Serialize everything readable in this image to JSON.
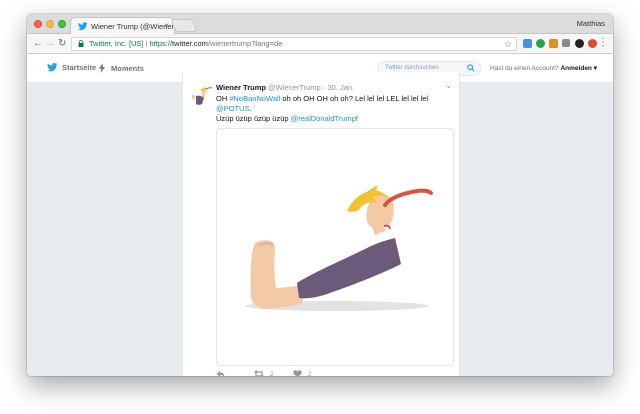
{
  "browser": {
    "tab_title": "Wiener Trump (@WienerTrump)",
    "tab_close": "×",
    "profile_name": "Matthias",
    "back_icon": "arrow-left-icon",
    "forward_icon": "arrow-right-icon",
    "reload_icon": "reload-icon",
    "secure_label": "Twitter, Inc. [US]",
    "url_scheme": "https://",
    "url_host": "twitter.com",
    "url_path": "/wienertrump?lang=de",
    "bookmark_icon": "star-icon",
    "menu_icon": "kebab-menu-icon"
  },
  "nav": {
    "home_label": "Startseite",
    "moments_label": "Moments",
    "search_placeholder": "Twitter durchsuchen",
    "account_question": "Hast du einen Account?",
    "login_label": "Anmelden"
  },
  "tweet": {
    "display_name": "Wiener Trump",
    "handle": "@WienerTrump",
    "dot": "·",
    "time": "30. Jan.",
    "text": {
      "t1": "OH ",
      "tag": "#NoBanNoWall",
      "t2": " oh oh OH OH oh oh? Lel lel lel LEL lel lel lel ",
      "mention1": "@POTUS",
      "t3": ".",
      "t4": "Üzüp üzüp üzüp üzüp ",
      "mention2": "@realDonaldTrump",
      "t5": "!"
    },
    "retweet_count": "2",
    "like_count": "2"
  },
  "colors": {
    "twitter_blue": "#1da1f2",
    "link_blue": "#1b95e0",
    "page_bg": "#e6ecf0"
  }
}
